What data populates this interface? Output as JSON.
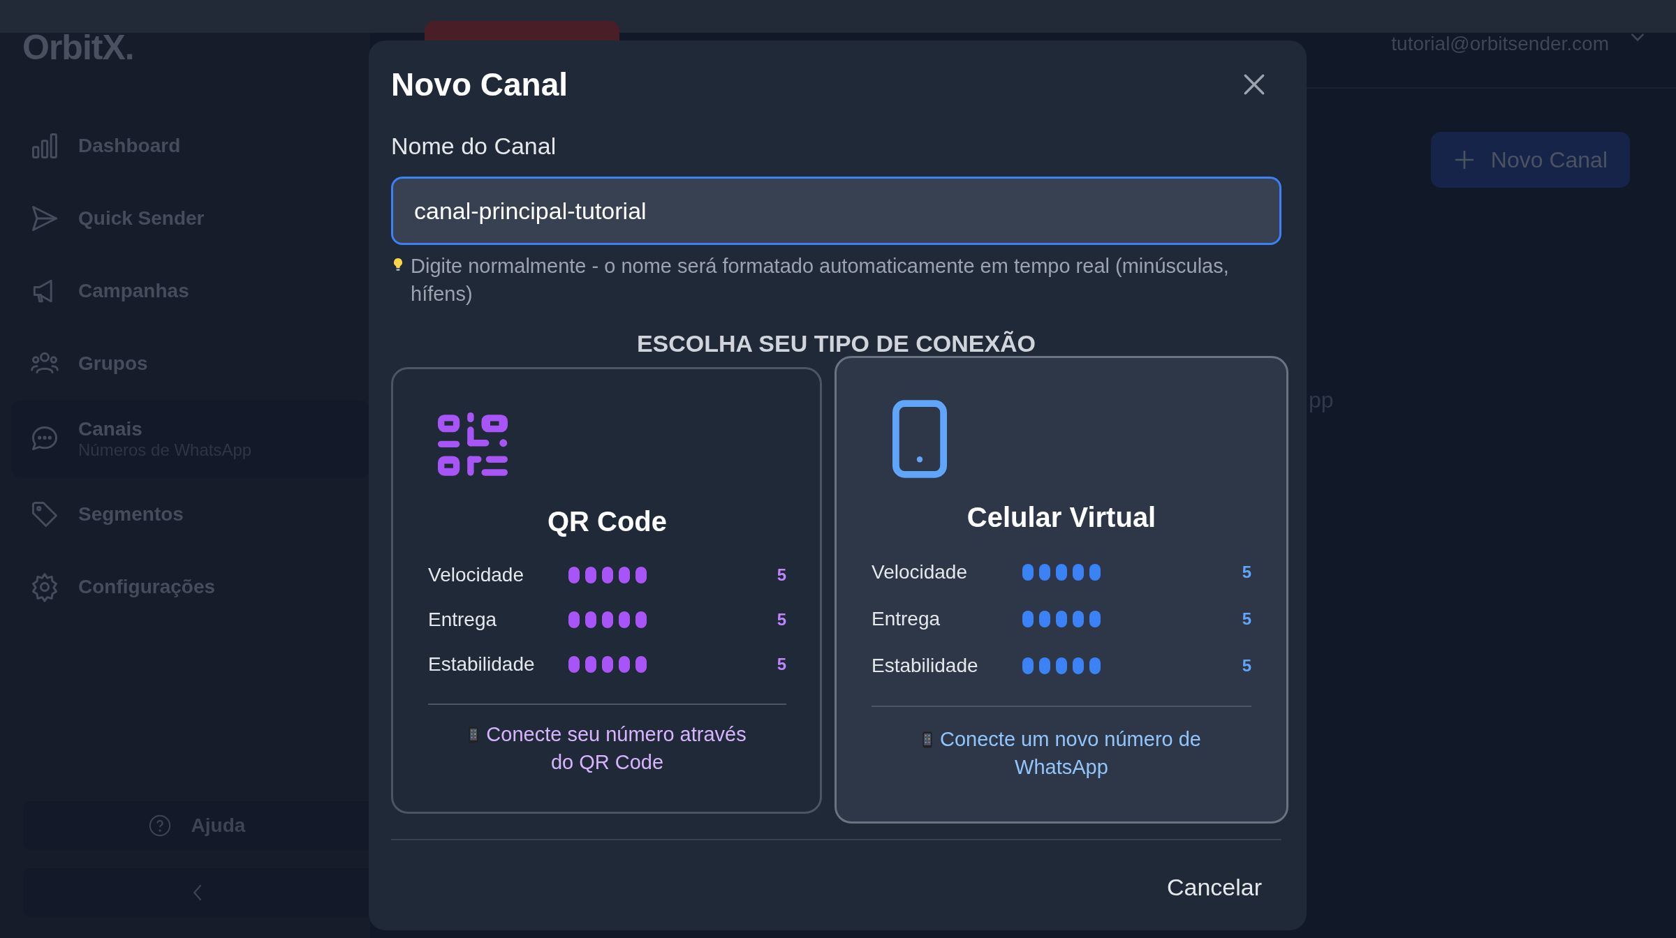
{
  "app": {
    "logo": "OrbitX."
  },
  "sidebar": {
    "items": [
      {
        "label": "Dashboard",
        "selected": false
      },
      {
        "label": "Quick Sender",
        "selected": false
      },
      {
        "label": "Campanhas",
        "selected": false
      },
      {
        "label": "Grupos",
        "selected": false
      },
      {
        "label": "Canais",
        "subtitle": "Números de WhatsApp",
        "selected": true
      },
      {
        "label": "Segmentos",
        "selected": false
      },
      {
        "label": "Configurações",
        "selected": false
      }
    ],
    "help_button": "Ajuda"
  },
  "header": {
    "user_email": "tutorial@orbitsender.com"
  },
  "main": {
    "new_button": "Novo Canal",
    "hidden_text_fragment": "pp"
  },
  "modal": {
    "title": "Novo Canal",
    "field": {
      "label": "Nome do Canal",
      "value": "canal-principal-tutorial",
      "focused": true
    },
    "hint": "Digite normalmente - o nome será formatado automaticamente em tempo real (minúsculas, hífens)",
    "section_title": "ESCOLHA SEU TIPO DE CONEXÃO",
    "options": [
      {
        "kind": "qr",
        "title": "QR Code",
        "selected": false,
        "metrics": [
          {
            "label": "Velocidade",
            "stars": 5,
            "value": "5"
          },
          {
            "label": "Entrega",
            "stars": 5,
            "value": "5"
          },
          {
            "label": "Estabilidade",
            "stars": 5,
            "value": "5"
          }
        ],
        "description": "Conecte seu número através do QR Code"
      },
      {
        "kind": "virtual",
        "title": "Celular Virtual",
        "selected": true,
        "metrics": [
          {
            "label": "Velocidade",
            "stars": 5,
            "value": "5"
          },
          {
            "label": "Entrega",
            "stars": 5,
            "value": "5"
          },
          {
            "label": "Estabilidade",
            "stars": 5,
            "value": "5"
          }
        ],
        "description": "Conecte um novo número de WhatsApp"
      }
    ],
    "cancel_button": "Cancelar"
  }
}
